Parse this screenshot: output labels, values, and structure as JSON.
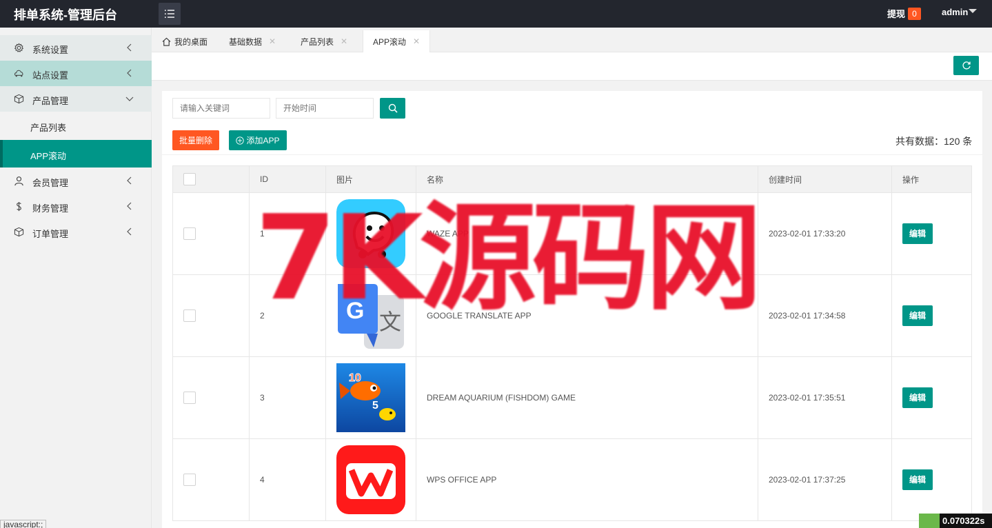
{
  "header": {
    "title": "排单系统-管理后台",
    "withdraw_label": "提现",
    "withdraw_count": "0",
    "user": "admin"
  },
  "sidebar": {
    "items": [
      {
        "label": "系统设置",
        "icon": "gear-icon"
      },
      {
        "label": "站点设置",
        "icon": "site-icon"
      },
      {
        "label": "产品管理",
        "icon": "box-icon"
      },
      {
        "label": "会员管理",
        "icon": "user-icon"
      },
      {
        "label": "财务管理",
        "icon": "dollar-icon"
      },
      {
        "label": "订单管理",
        "icon": "box-icon"
      }
    ],
    "sub_items": [
      {
        "label": "产品列表"
      },
      {
        "label": "APP滚动"
      }
    ]
  },
  "tabs": [
    {
      "label": "我的桌面"
    },
    {
      "label": "基础数据"
    },
    {
      "label": "产品列表"
    },
    {
      "label": "APP滚动"
    }
  ],
  "search": {
    "keyword_placeholder": "请输入关键词",
    "start_time_placeholder": "开始时间"
  },
  "toolbar": {
    "batch_delete": "批量删除",
    "add_app": "添加APP",
    "total": "共有数据：120 条"
  },
  "table": {
    "headers": [
      "ID",
      "图片",
      "名称",
      "创建时间",
      "操作"
    ],
    "rows": [
      {
        "id": "1",
        "name": "WAZE APP",
        "created": "2023-02-01 17:33:20",
        "action": "编辑"
      },
      {
        "id": "2",
        "name": "GOOGLE TRANSLATE APP",
        "created": "2023-02-01 17:34:58",
        "action": "编辑"
      },
      {
        "id": "3",
        "name": "DREAM AQUARIUM (FISHDOM) GAME",
        "created": "2023-02-01 17:35:51",
        "action": "编辑"
      },
      {
        "id": "4",
        "name": "WPS OFFICE APP",
        "created": "2023-02-01 17:37:25",
        "action": "编辑"
      }
    ]
  },
  "watermark": "7K源码网",
  "status_bar": "javascript:;",
  "timer": "0.070322s",
  "colors": {
    "primary": "#009688",
    "danger": "#ff5722",
    "header_bg": "#23262e"
  }
}
